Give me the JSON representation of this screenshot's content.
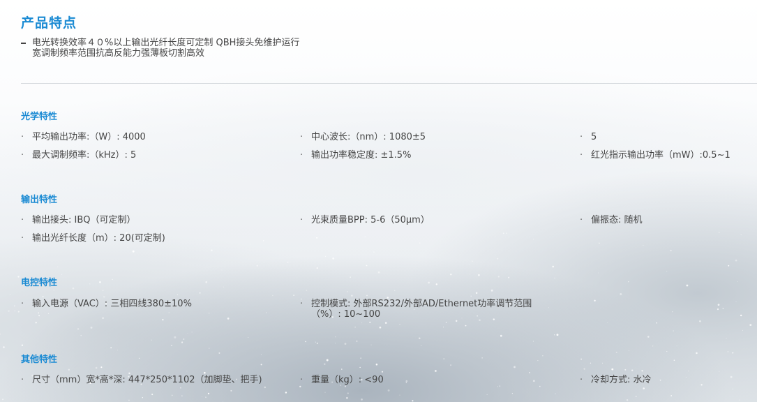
{
  "header": {
    "title": "产品特点",
    "intro_lines": [
      "电光转换效率４０%以上输出光纤长度可定制 QBH接头免维护运行",
      "宽调制频率范围抗高反能力强薄板切割高效"
    ]
  },
  "bullet_symbol": "·",
  "sections": [
    {
      "title": "光学特性",
      "items": [
        "平均输出功率:（W）: 4000",
        "中心波长:（nm）: 1080±5",
        "5",
        "最大调制频率:（kHz）: 5",
        "输出功率稳定度:  ±1.5%",
        "红光指示输出功率（mW）:0.5~1"
      ]
    },
    {
      "title": "输出特性",
      "items": [
        "输出接头: IBQ（可定制）",
        "光束质量BPP: 5-6（50μm）",
        "偏振态: 随机",
        "输出光纤长度（m）: 20(可定制)"
      ]
    },
    {
      "title": "电控特性",
      "items": [
        "输入电源（VAC）: 三相四线380±10%",
        "控制模式: 外部RS232/外部AD/Ethernet功率调节范围（%）: 10~100"
      ]
    },
    {
      "title": "其他特性",
      "items": [
        "尺寸（mm）宽*高*深: 447*250*1102（加脚垫、把手)",
        "重量（kg）: <90",
        "冷却方式: 水冷"
      ]
    }
  ],
  "colors": {
    "accent": "#1a8ad3",
    "text": "#444444",
    "divider": "#d5d9dd"
  }
}
